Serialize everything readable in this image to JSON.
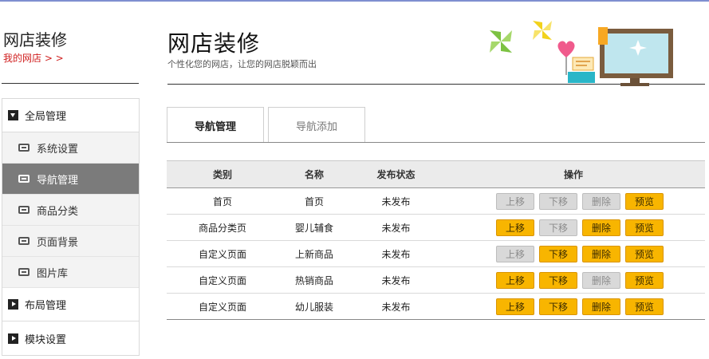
{
  "sidebar": {
    "title": "网店装修",
    "subtitle": "我的网店 > >",
    "groups": [
      {
        "label": "全局管理",
        "expanded": true
      },
      {
        "label": "布局管理",
        "expanded": false
      },
      {
        "label": "模块设置",
        "expanded": false
      }
    ],
    "items": [
      {
        "label": "系统设置",
        "active": false
      },
      {
        "label": "导航管理",
        "active": true
      },
      {
        "label": "商品分类",
        "active": false
      },
      {
        "label": "页面背景",
        "active": false
      },
      {
        "label": "图片库",
        "active": false
      }
    ]
  },
  "header": {
    "title": "网店装修",
    "subtitle": "个性化您的网店，让您的网店脱颖而出"
  },
  "tabs": [
    {
      "label": "导航管理",
      "active": true
    },
    {
      "label": "导航添加",
      "active": false
    }
  ],
  "table": {
    "columns": [
      "类别",
      "名称",
      "发布状态",
      "操作"
    ],
    "rows": [
      {
        "category": "首页",
        "name": "首页",
        "status": "未发布",
        "enabled": [
          false,
          false,
          false,
          true
        ]
      },
      {
        "category": "商品分类页",
        "name": "婴儿辅食",
        "status": "未发布",
        "enabled": [
          true,
          false,
          true,
          true
        ]
      },
      {
        "category": "自定义页面",
        "name": "上新商品",
        "status": "未发布",
        "enabled": [
          false,
          true,
          true,
          true
        ]
      },
      {
        "category": "自定义页面",
        "name": "热销商品",
        "status": "未发布",
        "enabled": [
          true,
          true,
          false,
          true
        ]
      },
      {
        "category": "自定义页面",
        "name": "幼儿服装",
        "status": "未发布",
        "enabled": [
          true,
          true,
          true,
          true
        ]
      }
    ],
    "actions": [
      "上移",
      "下移",
      "删除",
      "预览"
    ]
  },
  "colors": {
    "accent": "#f8b500",
    "disabled": "#d9d9d9",
    "active_nav": "#7b7b7b",
    "link_red": "#d01f1f"
  }
}
